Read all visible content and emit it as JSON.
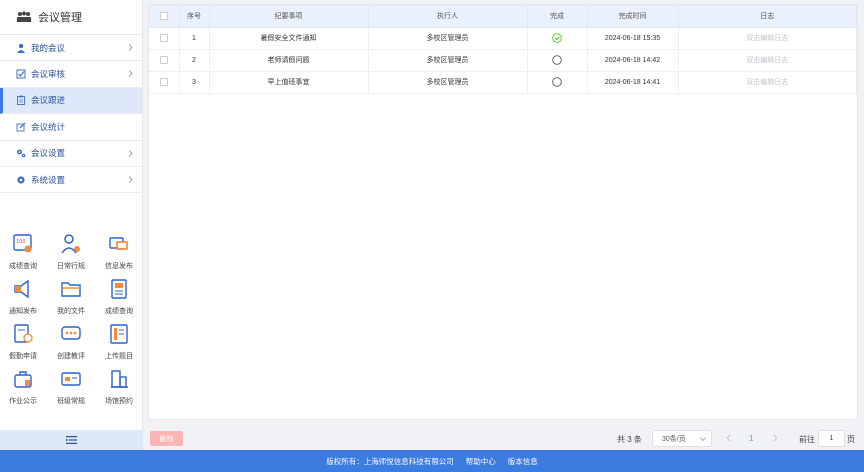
{
  "app": {
    "title": "会议管理"
  },
  "menu": [
    {
      "label": "我的会议",
      "icon": "user-icon",
      "chevron": true
    },
    {
      "label": "会议审核",
      "icon": "checkbox-icon",
      "chevron": true
    },
    {
      "label": "会议跟进",
      "icon": "clipboard-icon",
      "chevron": false
    },
    {
      "label": "会议统计",
      "icon": "edit-icon",
      "chevron": false
    },
    {
      "label": "会议设置",
      "icon": "gears-icon",
      "chevron": true
    },
    {
      "label": "系统设置",
      "icon": "gear-icon",
      "chevron": true
    }
  ],
  "apps": [
    {
      "label": "成绩查询"
    },
    {
      "label": "日常行规"
    },
    {
      "label": "信息发布"
    },
    {
      "label": "通知发布"
    },
    {
      "label": "我的文件"
    },
    {
      "label": "成绩查询"
    },
    {
      "label": "假勤申请"
    },
    {
      "label": "创建教评"
    },
    {
      "label": "上传题目"
    },
    {
      "label": "作业公示"
    },
    {
      "label": "班级常规"
    },
    {
      "label": "场馆预约"
    }
  ],
  "table": {
    "headers": [
      "序号",
      "纪要事项",
      "执行人",
      "完成",
      "完成时间",
      "日志"
    ],
    "rows": [
      {
        "no": "1",
        "item": "暑假安全文件通知",
        "executor": "多校区管理员",
        "done": true,
        "time": "2024-06-18 15:35",
        "log": "双击编辑日志"
      },
      {
        "no": "2",
        "item": "老师请假问题",
        "executor": "多校区管理员",
        "done": false,
        "time": "2024-06-18 14:42",
        "log": "双击编辑日志"
      },
      {
        "no": "3",
        "item": "早上值班事宜",
        "executor": "多校区管理员",
        "done": false,
        "time": "2024-06-18 14:41",
        "log": "双击编辑日志"
      }
    ]
  },
  "pager": {
    "delete_label": "删除",
    "total": "共 3 条",
    "page_size": "30条/页",
    "current": "1",
    "goto_label": "前往",
    "goto_value": "1",
    "unit": "页"
  },
  "footer": {
    "copyright": "版权所有：上海师悦信息科技有限公司",
    "help": "帮助中心",
    "version": "版本信息"
  },
  "colors": {
    "accent": "#3c7be0",
    "active_bg": "#dde8fb",
    "menu_text": "#2a4f9c",
    "done_green": "#52c41a"
  }
}
